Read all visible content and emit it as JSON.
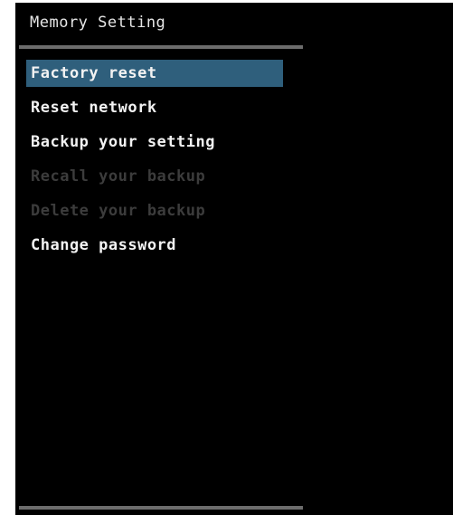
{
  "header": {
    "title": "Memory Setting"
  },
  "menu": {
    "items": [
      {
        "label": "Factory reset",
        "state": "selected"
      },
      {
        "label": "Reset network",
        "state": "enabled"
      },
      {
        "label": "Backup your setting",
        "state": "enabled"
      },
      {
        "label": "Recall your backup",
        "state": "disabled"
      },
      {
        "label": "Delete your backup",
        "state": "disabled"
      },
      {
        "label": "Change password",
        "state": "enabled"
      }
    ]
  },
  "colors": {
    "background": "#000000",
    "highlight": "#2f5f7c",
    "text": "#f2f2f2",
    "disabled_text": "#3c3c3c",
    "divider": "#6c6c6c"
  }
}
